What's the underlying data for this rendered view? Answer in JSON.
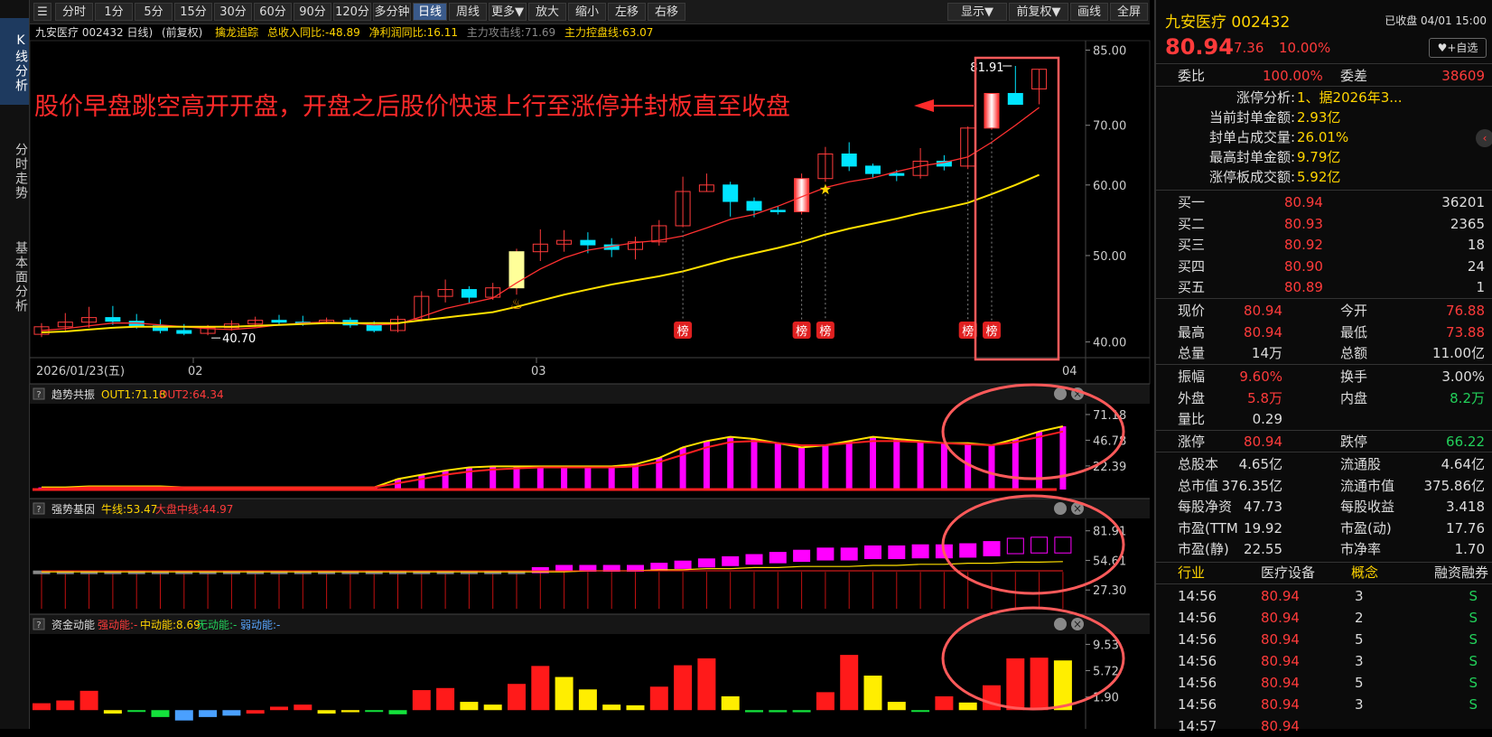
{
  "left_tabs": [
    "K线分析",
    "分时走势",
    "基本面分析"
  ],
  "toolbar": {
    "buttons": [
      "分时",
      "1分",
      "5分",
      "15分",
      "30分",
      "60分",
      "90分",
      "120分",
      "多分钟",
      "日线",
      "周线",
      "更多▼",
      "放大",
      "缩小",
      "左移",
      "右移"
    ],
    "right_buttons": [
      "显示▼",
      "前复权▼",
      "画线",
      "全屏"
    ],
    "active": "日线"
  },
  "main_header": {
    "title": "九安医疗 002432 日线)",
    "adj": "(前复权)",
    "indicator": "擒龙追踪",
    "v1": "总收入同比:-48.89",
    "v2": "净利润同比:16.11",
    "v3": "主力攻击线:71.69",
    "v4": "主力控盘线:63.07"
  },
  "main_yaxis": [
    "85.00",
    "70.00",
    "60.00",
    "50.00",
    "40.00"
  ],
  "main_xaxis": [
    "2026/01/23(五)",
    "02",
    "03",
    "04"
  ],
  "annotation_text": "股价早盘跳空高开开盘，开盘之后股价快速上行至涨停并封板直至收盘",
  "price_labels": {
    "high": "81.91",
    "low": "40.70"
  },
  "badge_text": "榜",
  "chart_data": [
    {
      "type": "candlestick",
      "candles": [
        [
          40.8,
          41.6,
          40.5,
          42.0
        ],
        [
          41.6,
          42.1,
          41.2,
          43.1
        ],
        [
          42.1,
          42.6,
          41.5,
          43.8
        ],
        [
          42.6,
          42.2,
          41.8,
          43.9
        ],
        [
          42.2,
          41.7,
          41.4,
          43.0
        ],
        [
          41.7,
          41.2,
          40.9,
          42.4
        ],
        [
          41.2,
          40.9,
          40.7,
          41.9
        ],
        [
          40.9,
          41.5,
          40.7,
          41.8
        ],
        [
          41.5,
          41.9,
          41.2,
          42.3
        ],
        [
          41.9,
          42.3,
          41.6,
          42.7
        ],
        [
          42.3,
          42.1,
          41.8,
          42.9
        ],
        [
          42.1,
          42.0,
          41.7,
          42.8
        ],
        [
          42.0,
          42.3,
          41.9,
          42.6
        ],
        [
          42.3,
          41.8,
          41.5,
          42.6
        ],
        [
          41.8,
          41.2,
          41.0,
          42.2
        ],
        [
          41.2,
          42.4,
          41.0,
          42.8
        ],
        [
          42.4,
          45.0,
          42.2,
          45.6
        ],
        [
          45.0,
          45.8,
          44.3,
          47.0
        ],
        [
          45.8,
          44.9,
          44.2,
          46.2
        ],
        [
          44.9,
          46.0,
          44.6,
          46.6
        ],
        [
          46.0,
          50.5,
          45.2,
          50.9
        ],
        [
          50.5,
          51.5,
          49.3,
          53.5
        ],
        [
          51.5,
          52.0,
          50.5,
          53.4
        ],
        [
          52.0,
          51.4,
          50.3,
          53.1
        ],
        [
          51.4,
          50.8,
          49.8,
          52.3
        ],
        [
          50.8,
          51.8,
          49.5,
          52.5
        ],
        [
          51.8,
          54.0,
          51.3,
          54.8
        ],
        [
          54.0,
          59.0,
          53.8,
          61.3
        ],
        [
          59.0,
          60.0,
          59.0,
          61.8
        ],
        [
          60.0,
          57.5,
          55.3,
          60.5
        ],
        [
          57.5,
          56.2,
          55.2,
          58.1
        ],
        [
          56.2,
          56.0,
          55.6,
          56.8
        ],
        [
          56.0,
          61.0,
          55.6,
          61.8
        ],
        [
          61.0,
          65.0,
          60.5,
          66.2
        ],
        [
          65.0,
          63.0,
          62.2,
          67.0
        ],
        [
          63.0,
          61.8,
          61.2,
          63.4
        ],
        [
          61.8,
          61.5,
          60.6,
          62.4
        ],
        [
          61.5,
          63.8,
          61.0,
          66.0
        ],
        [
          63.8,
          63.0,
          62.3,
          64.8
        ],
        [
          63.0,
          69.5,
          62.5,
          69.8
        ],
        [
          69.5,
          76.0,
          69.2,
          76.0
        ],
        [
          76.0,
          73.9,
          73.9,
          81.6
        ],
        [
          76.9,
          80.9,
          73.9,
          80.9
        ]
      ],
      "ma5": [
        41.2,
        41.4,
        41.7,
        42.0,
        42.0,
        41.8,
        41.6,
        41.4,
        41.3,
        41.5,
        41.8,
        42.0,
        42.1,
        42.0,
        41.8,
        41.9,
        42.7,
        43.6,
        44.2,
        44.8,
        46.6,
        48.3,
        49.7,
        50.7,
        51.2,
        51.7,
        52.0,
        52.6,
        53.7,
        54.9,
        55.6,
        56.8,
        58.2,
        59.6,
        60.5,
        61.1,
        62.1,
        63.0,
        63.6,
        64.5,
        67.0,
        70.0,
        73.3
      ],
      "ma_long": [
        41.0,
        41.1,
        41.3,
        41.5,
        41.6,
        41.6,
        41.6,
        41.6,
        41.6,
        41.7,
        41.8,
        41.9,
        42.0,
        42.0,
        42.0,
        42.0,
        42.3,
        42.6,
        42.9,
        43.2,
        43.8,
        44.5,
        45.2,
        45.8,
        46.4,
        46.9,
        47.4,
        48.0,
        48.8,
        49.6,
        50.3,
        51.0,
        51.8,
        52.8,
        53.6,
        54.3,
        55.0,
        55.8,
        56.5,
        57.3,
        58.6,
        60.0,
        61.6
      ],
      "ylim": [
        38.5,
        86.5
      ],
      "yscale": "log",
      "badges_at": [
        27,
        32,
        33,
        39,
        40
      ],
      "star_at": 33,
      "flame_at": 20,
      "high_label_at": 41,
      "low_label_at": 7
    },
    {
      "type": "bar_line",
      "name": "趋势共振",
      "label_out1": "OUT1:71.18",
      "label_out2": "OUT2:64.34",
      "bars": [
        2,
        2,
        3,
        3,
        3,
        3,
        2,
        2,
        2,
        2,
        2,
        2,
        2,
        2,
        2,
        10,
        14,
        18,
        21,
        22,
        22,
        22,
        22,
        22,
        22,
        24,
        30,
        40,
        46,
        50,
        48,
        44,
        40,
        42,
        46,
        50,
        48,
        46,
        44,
        44,
        42,
        48,
        55,
        60,
        66
      ],
      "out1": [
        2,
        2,
        3,
        3,
        3,
        3,
        2,
        2,
        2,
        2,
        2,
        2,
        2,
        2,
        2,
        10,
        14,
        18,
        21,
        22,
        22,
        22,
        22,
        22,
        22,
        24,
        30,
        40,
        46,
        50,
        48,
        44,
        40,
        42,
        46,
        50,
        48,
        46,
        44,
        44,
        42,
        48,
        55,
        60,
        71
      ],
      "out2": [
        1,
        1,
        2,
        2,
        2,
        2,
        2,
        2,
        2,
        2,
        2,
        2,
        2,
        2,
        2,
        6,
        10,
        14,
        17,
        19,
        20,
        21,
        21,
        21,
        21,
        22,
        26,
        33,
        40,
        45,
        46,
        44,
        42,
        42,
        44,
        46,
        46,
        45,
        44,
        43,
        42,
        45,
        50,
        55,
        64
      ],
      "ylim": [
        0,
        78
      ],
      "ticks": [
        "71.18",
        "46.78",
        "22.39"
      ]
    },
    {
      "type": "bar_line",
      "name": "强势基因",
      "label_bull": "牛线:53.47",
      "label_market": "大盘中线:44.97",
      "bars": [
        44,
        44,
        44,
        44,
        44,
        44,
        44,
        44,
        44,
        44,
        44,
        44,
        44,
        44,
        44,
        44,
        44,
        44,
        44,
        44,
        44,
        48,
        50,
        50,
        50,
        50,
        52,
        54,
        56,
        58,
        60,
        62,
        64,
        66,
        66,
        68,
        68,
        69,
        69,
        70,
        72,
        75,
        76,
        76
      ],
      "bull": [
        44,
        44,
        44,
        44,
        44,
        44,
        44,
        44,
        44,
        44,
        44,
        44,
        44,
        44,
        44,
        44,
        44,
        44,
        44,
        44,
        44,
        44,
        44,
        45,
        45,
        45,
        46,
        46,
        47,
        47,
        48,
        48,
        49,
        49,
        49,
        50,
        50,
        51,
        51,
        52,
        52,
        53,
        53,
        53.5
      ],
      "market": [
        45,
        45,
        45,
        45,
        45,
        45,
        45,
        45,
        45,
        45,
        45,
        45,
        45,
        45,
        45,
        45,
        45,
        45,
        45,
        45,
        45,
        45,
        45,
        45,
        45,
        45,
        45,
        45,
        45,
        45,
        45,
        45,
        45,
        45,
        45,
        45,
        45,
        45,
        45,
        45,
        45,
        45,
        45,
        45
      ],
      "ylim": [
        10,
        90
      ],
      "ticks": [
        "81.91",
        "54.61",
        "27.30"
      ]
    },
    {
      "type": "bar",
      "name": "资金动能",
      "label_strong": "强动能:-",
      "label_mid": "中动能:8.69",
      "label_none": "无动能:-",
      "label_weak": "弱动能:-",
      "values": [
        1,
        1.4,
        2.8,
        -0.5,
        -0.2,
        -1,
        -1.5,
        -1,
        -0.8,
        -0.5,
        0.5,
        0.8,
        -0.5,
        -0.3,
        -0.2,
        -0.6,
        2.9,
        3.2,
        1.2,
        0.8,
        3.8,
        6.4,
        4.8,
        3.0,
        0.8,
        0.7,
        3.4,
        6.5,
        7.5,
        2.0,
        -0.3,
        -0.3,
        -0.3,
        2.6,
        8.0,
        5.0,
        1.2,
        -0.2,
        2.0,
        1.1,
        3.6,
        7.5,
        7.6,
        7.2
      ],
      "colors": [
        "red",
        "red",
        "red",
        "yellow",
        "green",
        "green",
        "blue",
        "blue",
        "blue",
        "red",
        "red",
        "red",
        "yellow",
        "yellow",
        "green",
        "green",
        "red",
        "red",
        "yellow",
        "yellow",
        "red",
        "red",
        "yellow",
        "yellow",
        "yellow",
        "yellow",
        "red",
        "red",
        "red",
        "yellow",
        "green",
        "green",
        "green",
        "red",
        "red",
        "yellow",
        "yellow",
        "green",
        "red",
        "yellow",
        "red",
        "red",
        "red",
        "yellow"
      ],
      "ylim": [
        -1.8,
        10.5
      ],
      "ticks": [
        "9.53",
        "5.72",
        "1.90"
      ]
    }
  ],
  "right_panel": {
    "name": "九安医疗 002432",
    "status": "已收盘 04/01 15:00",
    "price": "80.94",
    "change": "7.36",
    "pct": "10.00%",
    "fav_button": "+自选",
    "weibi_label": "委比",
    "weibi_value": "100.00%",
    "weicha_label": "委差",
    "weicha_value": "38609",
    "limit_analysis": [
      {
        "label": "涨停分析:",
        "value": "1、据2026年3..."
      },
      {
        "label": "当前封单金额:",
        "value": "2.93亿"
      },
      {
        "label": "封单占成交量:",
        "value": "26.01%"
      },
      {
        "label": "最高封单金额:",
        "value": "9.79亿"
      },
      {
        "label": "涨停板成交额:",
        "value": "5.92亿"
      }
    ],
    "bids": [
      {
        "label": "买一",
        "price": "80.94",
        "vol": "36201"
      },
      {
        "label": "买二",
        "price": "80.93",
        "vol": "2365"
      },
      {
        "label": "买三",
        "price": "80.92",
        "vol": "18"
      },
      {
        "label": "买四",
        "price": "80.90",
        "vol": "24"
      },
      {
        "label": "买五",
        "price": "80.89",
        "vol": "1"
      }
    ],
    "stats": [
      {
        "l1": "现价",
        "v1": "80.94",
        "c1": "red",
        "l2": "今开",
        "v2": "76.88",
        "c2": "red"
      },
      {
        "l1": "最高",
        "v1": "80.94",
        "c1": "red",
        "l2": "最低",
        "v2": "73.88",
        "c2": "red"
      },
      {
        "l1": "总量",
        "v1": "14万",
        "c1": "white",
        "l2": "总额",
        "v2": "11.00亿",
        "c2": "white"
      }
    ],
    "stats2": [
      {
        "l1": "振幅",
        "v1": "9.60%",
        "c1": "red",
        "l2": "换手",
        "v2": "3.00%",
        "c2": "white"
      },
      {
        "l1": "外盘",
        "v1": "5.8万",
        "c1": "red",
        "l2": "内盘",
        "v2": "8.2万",
        "c2": "green"
      },
      {
        "l1": "量比",
        "v1": "0.29",
        "c1": "white",
        "l2": "",
        "v2": "",
        "c2": "white"
      }
    ],
    "stats3": [
      {
        "l1": "涨停",
        "v1": "80.94",
        "c1": "red",
        "l2": "跌停",
        "v2": "66.22",
        "c2": "green"
      }
    ],
    "fundamentals": [
      {
        "l1": "总股本",
        "v1": "4.65亿",
        "l2": "流通股",
        "v2": "4.64亿"
      },
      {
        "l1": "总市值",
        "v1": "376.35亿",
        "l2": "流通市值",
        "v2": "375.86亿"
      },
      {
        "l1": "每股净资",
        "v1": "47.73",
        "l2": "每股收益",
        "v2": "3.418"
      },
      {
        "l1": "市盈(TTM",
        "v1": "19.92",
        "l2": "市盈(动)",
        "v2": "17.76"
      },
      {
        "l1": "市盈(静)",
        "v1": "22.55",
        "l2": "市净率",
        "v2": "1.70"
      }
    ],
    "industry_row": {
      "l1": "行业",
      "v1": "医疗设备",
      "l2": "概念",
      "v2": "融资融券"
    },
    "ticks": [
      {
        "time": "14:56",
        "price": "80.94",
        "vol": "3",
        "side": "S"
      },
      {
        "time": "14:56",
        "price": "80.94",
        "vol": "2",
        "side": "S"
      },
      {
        "time": "14:56",
        "price": "80.94",
        "vol": "5",
        "side": "S"
      },
      {
        "time": "14:56",
        "price": "80.94",
        "vol": "3",
        "side": "S"
      },
      {
        "time": "14:56",
        "price": "80.94",
        "vol": "5",
        "side": "S"
      },
      {
        "time": "14:56",
        "price": "80.94",
        "vol": "3",
        "side": "S"
      },
      {
        "time": "14:57",
        "price": "80.94",
        "vol": "",
        "side": ""
      }
    ]
  },
  "colors": {
    "up": "#ff3b3b",
    "down": "#00e5ff",
    "ma5": "#ff3030",
    "ma_long": "#ffe000",
    "magenta": "#ff00ff",
    "annotation": "#ff2a2a",
    "circle": "#ff5a5a"
  }
}
